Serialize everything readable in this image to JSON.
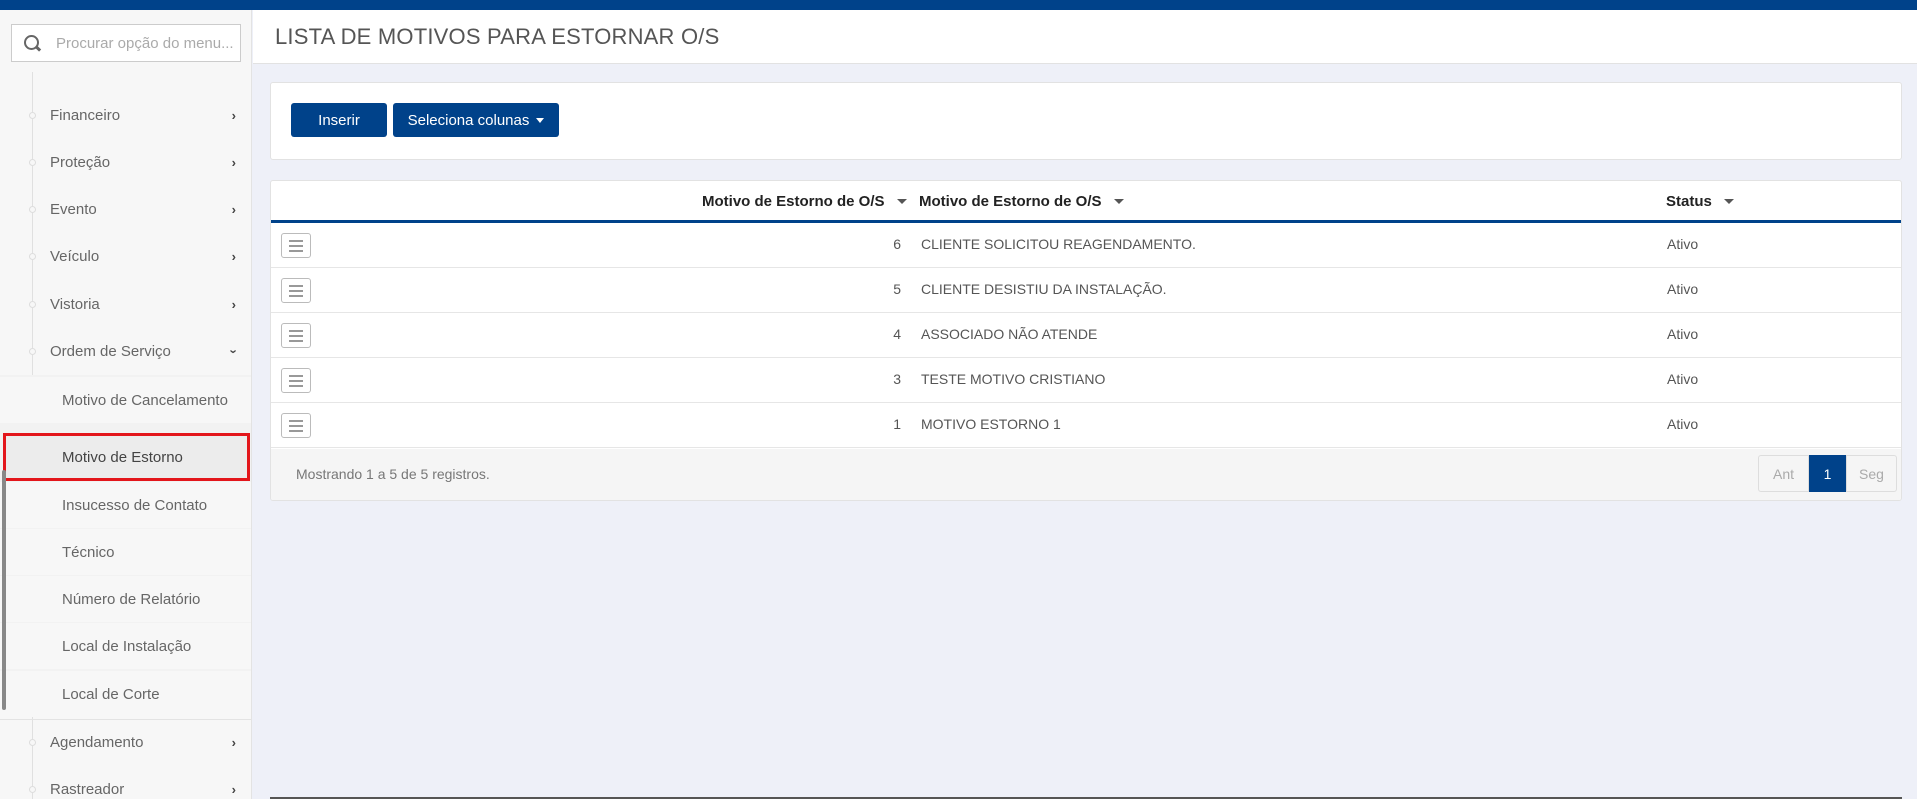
{
  "header": {
    "title": "LISTA DE MOTIVOS PARA ESTORNAR O/S"
  },
  "search": {
    "placeholder": "Procurar opção do menu..."
  },
  "sidebar": {
    "items": [
      {
        "label": "Financeiro"
      },
      {
        "label": "Proteção"
      },
      {
        "label": "Evento"
      },
      {
        "label": "Veículo"
      },
      {
        "label": "Vistoria"
      },
      {
        "label": "Ordem de Serviço"
      },
      {
        "label": "Agendamento"
      },
      {
        "label": "Rastreador"
      }
    ],
    "sub_items": [
      {
        "label": "Motivo de Cancelamento"
      },
      {
        "label": "Motivo de Estorno"
      },
      {
        "label": "Insucesso de Contato"
      },
      {
        "label": "Técnico"
      },
      {
        "label": "Número de Relatório"
      },
      {
        "label": "Local de Instalação"
      },
      {
        "label": "Local de Corte"
      }
    ]
  },
  "toolbar": {
    "insert_label": "Inserir",
    "columns_label": "Seleciona colunas"
  },
  "table": {
    "columns": [
      "Motivo de Estorno de O/S",
      "Motivo de Estorno de O/S",
      "Status"
    ],
    "rows": [
      {
        "id": "6",
        "desc": "CLIENTE SOLICITOU REAGENDAMENTO.",
        "status": "Ativo"
      },
      {
        "id": "5",
        "desc": "CLIENTE DESISTIU DA INSTALAÇÃO.",
        "status": "Ativo"
      },
      {
        "id": "4",
        "desc": "ASSOCIADO NÃO ATENDE",
        "status": "Ativo"
      },
      {
        "id": "3",
        "desc": "TESTE MOTIVO CRISTIANO",
        "status": "Ativo"
      },
      {
        "id": "1",
        "desc": "MOTIVO ESTORNO 1",
        "status": "Ativo"
      }
    ],
    "footer_info": "Mostrando 1 a 5 de 5 registros."
  },
  "pagination": {
    "prev": "Ant",
    "current": "1",
    "next": "Seg"
  },
  "colors": {
    "primary": "#00428a",
    "highlight": "#e3161b"
  }
}
